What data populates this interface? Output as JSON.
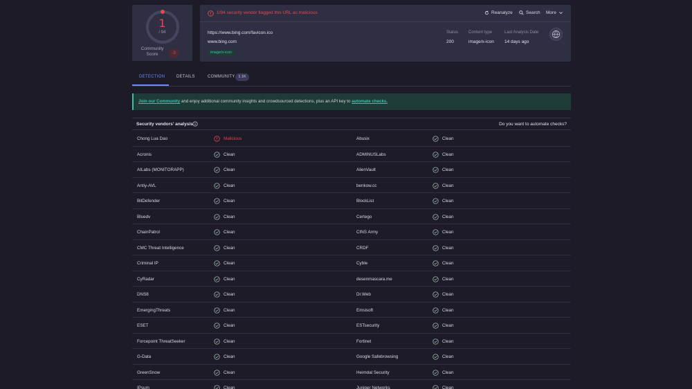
{
  "score": {
    "value": "1",
    "total": "/ 94",
    "label": "Community Score",
    "community_vote": "-3"
  },
  "header": {
    "alert": "1/94 security vendor flagged this URL as malicious",
    "actions": {
      "reanalyze": "Reanalyze",
      "search": "Search",
      "more": "More"
    },
    "url": "https://www.bing.com/favicon.ico",
    "host": "www.bing.com",
    "tag": "image/x-icon",
    "meta": {
      "status_label": "Status",
      "status_value": "200",
      "content_label": "Content type",
      "content_value": "image/x-icon",
      "date_label": "Last Analysis Date",
      "date_value": "14 days ago"
    }
  },
  "tabs": {
    "detection": "DETECTION",
    "details": "DETAILS",
    "community": "COMMUNITY",
    "community_count": "1.1K"
  },
  "banner": {
    "link1": "Join our Community",
    "mid": " and enjoy additional community insights and crowdsourced detections, plus an API key to ",
    "link2": "automate checks."
  },
  "vendors": {
    "title": "Security vendors' analysis",
    "automate": "Do you want to automate checks?",
    "rows": [
      {
        "l": "Chong Lua Dao",
        "lr": "Malicious",
        "r": "Abusix",
        "rr": "Clean"
      },
      {
        "l": "Acronis",
        "lr": "Clean",
        "r": "ADMINUSLabs",
        "rr": "Clean"
      },
      {
        "l": "AILabs (MONITORAPP)",
        "lr": "Clean",
        "r": "AlienVault",
        "rr": "Clean"
      },
      {
        "l": "Antiy-AVL",
        "lr": "Clean",
        "r": "benkow.cc",
        "rr": "Clean"
      },
      {
        "l": "BitDefender",
        "lr": "Clean",
        "r": "BlockList",
        "rr": "Clean"
      },
      {
        "l": "Bluedv",
        "lr": "Clean",
        "r": "Certego",
        "rr": "Clean"
      },
      {
        "l": "ChainPatrol",
        "lr": "Clean",
        "r": "CINS Army",
        "rr": "Clean"
      },
      {
        "l": "CMC Threat Intelligence",
        "lr": "Clean",
        "r": "CRDF",
        "rr": "Clean"
      },
      {
        "l": "Criminal IP",
        "lr": "Clean",
        "r": "Cyble",
        "rr": "Clean"
      },
      {
        "l": "CyRadar",
        "lr": "Clean",
        "r": "desenmascara.me",
        "rr": "Clean"
      },
      {
        "l": "DNS8",
        "lr": "Clean",
        "r": "Dr.Web",
        "rr": "Clean"
      },
      {
        "l": "EmergingThreats",
        "lr": "Clean",
        "r": "Emsisoft",
        "rr": "Clean"
      },
      {
        "l": "ESET",
        "lr": "Clean",
        "r": "ESTsecurity",
        "rr": "Clean"
      },
      {
        "l": "Forcepoint ThreatSeeker",
        "lr": "Clean",
        "r": "Fortinet",
        "rr": "Clean"
      },
      {
        "l": "G-Data",
        "lr": "Clean",
        "r": "Google Safebrowsing",
        "rr": "Clean"
      },
      {
        "l": "GreenSnow",
        "lr": "Clean",
        "r": "Heimdal Security",
        "rr": "Clean"
      },
      {
        "l": "IPsum",
        "lr": "Clean",
        "r": "Juniper Networks",
        "rr": "Clean"
      }
    ]
  },
  "colors": {
    "malicious": "#e5484d",
    "accent": "#6e8dfb",
    "teal": "#37c3a8"
  }
}
